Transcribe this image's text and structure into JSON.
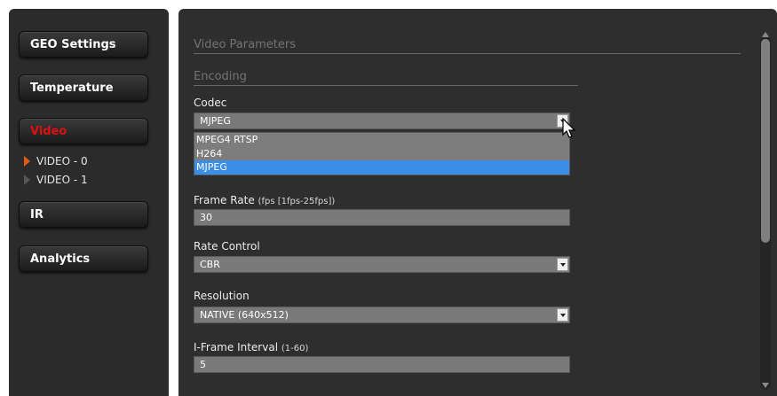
{
  "sidebar": {
    "buttons": [
      {
        "label": "GEO Settings"
      },
      {
        "label": "Temperature"
      },
      {
        "label": "Video"
      },
      {
        "label": "IR"
      },
      {
        "label": "Analytics"
      }
    ],
    "video_subitems": [
      {
        "label": "VIDEO - 0",
        "active": true
      },
      {
        "label": "VIDEO - 1",
        "active": false
      }
    ],
    "active_button": "Video",
    "active_color": "#e01010"
  },
  "main": {
    "section_title": "Video Parameters",
    "subsection_title": "Encoding",
    "codec": {
      "label": "Codec",
      "value": "MJPEG",
      "options": [
        "MPEG4 RTSP",
        "H264",
        "MJPEG"
      ],
      "highlighted_option": "MJPEG",
      "expanded": true
    },
    "frame_rate": {
      "label": "Frame Rate",
      "hint": "(fps [1fps-25fps])",
      "value": "30"
    },
    "rate_control": {
      "label": "Rate Control",
      "value": "CBR"
    },
    "resolution": {
      "label": "Resolution",
      "value": "NATIVE (640x512)"
    },
    "iframe_interval": {
      "label": "I-Frame Interval",
      "hint": "(1-60)",
      "value": "5"
    }
  },
  "icons": {
    "dropdown": "chevron-down-icon",
    "subitem_marker": "play-arrow-icon",
    "cursor": "mouse-pointer-icon"
  },
  "colors": {
    "selection_highlight": "#3a8ee6",
    "active_subitem_marker": "#e35a10"
  }
}
